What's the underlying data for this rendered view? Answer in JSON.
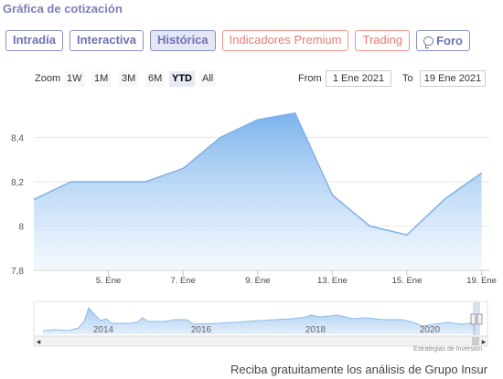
{
  "title": "Gráfica de cotización",
  "tabs": [
    {
      "label": "Intradía",
      "style": "normal"
    },
    {
      "label": "Interactiva",
      "style": "normal"
    },
    {
      "label": "Histórica",
      "style": "active"
    },
    {
      "label": "Indicadores Premium",
      "style": "premium"
    },
    {
      "label": "Trading",
      "style": "premium"
    },
    {
      "label": "Foro",
      "style": "foro",
      "icon": "chat-bubble-icon"
    }
  ],
  "zoom": {
    "label": "Zoom",
    "options": [
      "1W",
      "1M",
      "3M",
      "6M",
      "YTD",
      "All"
    ],
    "selected": "YTD"
  },
  "range": {
    "from_label": "From",
    "from_value": "1 Ene 2021",
    "to_label": "To",
    "to_value": "19 Ene 2021"
  },
  "navigator": {
    "year_labels": [
      "2014",
      "2016",
      "2018",
      "2020"
    ],
    "left_arrow": "◂",
    "right_arrow": "▸"
  },
  "credit": "Estrategias de Inversión",
  "promo": "Reciba gratuitamente los análisis de Grupo Insur",
  "colors": {
    "accent": "#7b7fb8",
    "premium": "#ea7a70",
    "series_line": "#7fb0e8",
    "series_fill_top": "#7ab3ec"
  },
  "chart_data": {
    "type": "area",
    "x": [
      "1 Ene",
      "4 Ene",
      "5 Ene",
      "6 Ene",
      "7 Ene",
      "8 Ene",
      "11 Ene",
      "12 Ene",
      "13 Ene",
      "14 Ene",
      "15 Ene",
      "18 Ene",
      "19 Ene"
    ],
    "values": [
      8.12,
      8.2,
      8.2,
      8.2,
      8.26,
      8.4,
      8.48,
      8.51,
      8.14,
      8.0,
      7.96,
      8.12,
      8.24
    ],
    "x_ticks": [
      "5. Ene",
      "7. Ene",
      "9. Ene",
      "13. Ene",
      "15. Ene",
      "19. Ene"
    ],
    "y_ticks": [
      "7,8",
      "8",
      "8,2",
      "8,4"
    ],
    "ylim": [
      7.8,
      8.6
    ],
    "grid": true,
    "legend": "none"
  }
}
